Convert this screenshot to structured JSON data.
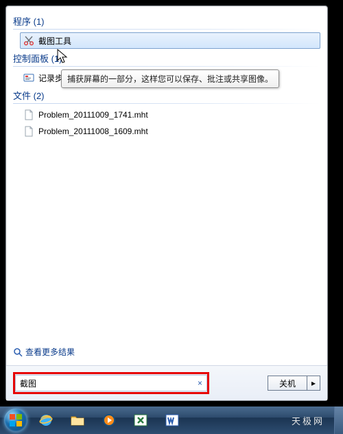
{
  "sections": {
    "programs": {
      "header": "程序 (1)"
    },
    "control": {
      "header": "控制面板 (1)"
    },
    "files": {
      "header": "文件 (2)"
    }
  },
  "program_item": {
    "label": "截图工具"
  },
  "control_item": {
    "label": "记录步骤以再现问题"
  },
  "file_items": [
    "Problem_20111009_1741.mht",
    "Problem_20111008_1609.mht"
  ],
  "tooltip": "捕获屏幕的一部分，这样您可以保存、批注或共享图像。",
  "more_results": "查看更多结果",
  "search": {
    "value": "截图",
    "clear": "×"
  },
  "shutdown": {
    "label": "关机",
    "arrow": "▸"
  },
  "watermark": "天极网"
}
